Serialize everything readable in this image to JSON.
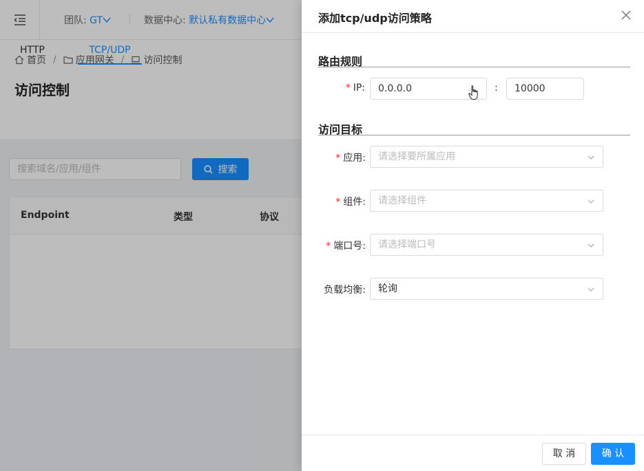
{
  "topbar": {
    "team_label": "团队:",
    "team_value": "GT",
    "dc_label": "数据中心:",
    "dc_value": "默认私有数据中心"
  },
  "breadcrumb": {
    "home": "首页",
    "gateway": "应用网关",
    "access": "访问控制"
  },
  "page": {
    "title": "访问控制",
    "tabs": [
      {
        "label": "HTTP"
      },
      {
        "label": "TCP/UDP"
      }
    ],
    "search_placeholder": "搜索域名/应用/组件",
    "search_button": "搜索"
  },
  "table": {
    "columns": [
      "Endpoint",
      "类型",
      "协议"
    ]
  },
  "drawer": {
    "title": "添加tcp/udp访问策略",
    "section_route": "路由规则",
    "section_target": "访问目标",
    "ip_label": "IP:",
    "ip_value": "0.0.0.0",
    "port_separator": ":",
    "port_value": "10000",
    "app_label": "应用:",
    "app_placeholder": "请选择要所属应用",
    "component_label": "组件:",
    "component_placeholder": "请选择组件",
    "port_label": "端口号:",
    "port_placeholder": "请选择端口号",
    "lb_label": "负载均衡:",
    "lb_value": "轮询",
    "cancel": "取 消",
    "confirm": "确 认"
  },
  "colors": {
    "primary": "#1890ff",
    "required": "#f5222d"
  }
}
